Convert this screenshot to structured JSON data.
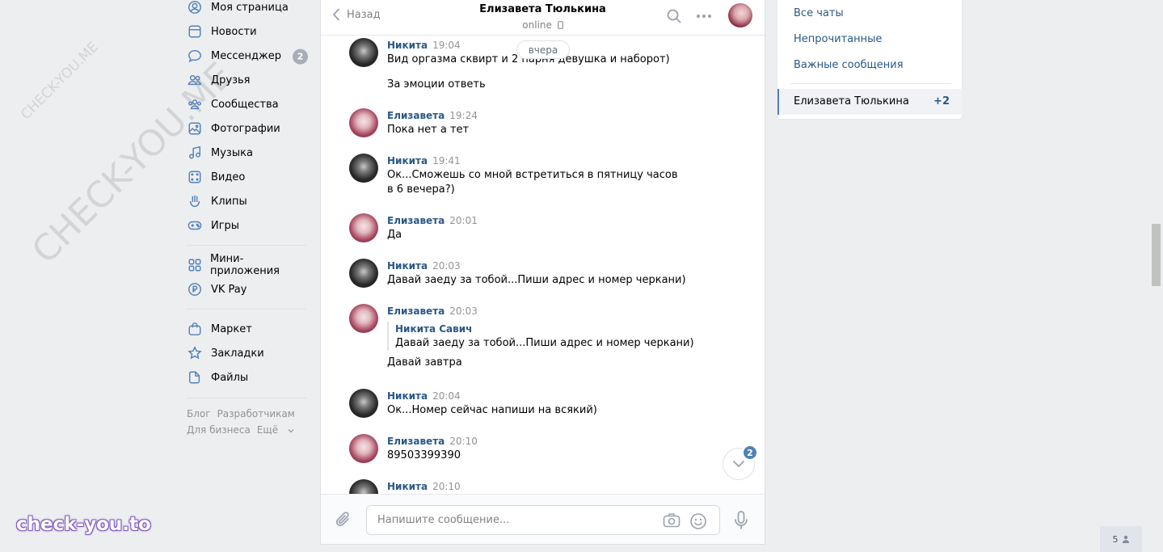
{
  "nav": {
    "items": [
      {
        "label": "Моя страница",
        "icon": "user-circle-icon"
      },
      {
        "label": "Новости",
        "icon": "news-icon"
      },
      {
        "label": "Мессенджер",
        "icon": "message-icon",
        "badge": "2"
      },
      {
        "label": "Друзья",
        "icon": "friends-icon"
      },
      {
        "label": "Сообщества",
        "icon": "communities-icon"
      },
      {
        "label": "Фотографии",
        "icon": "photo-icon"
      },
      {
        "label": "Музыка",
        "icon": "music-icon"
      },
      {
        "label": "Видео",
        "icon": "video-icon"
      },
      {
        "label": "Клипы",
        "icon": "clips-icon"
      },
      {
        "label": "Игры",
        "icon": "games-icon"
      }
    ],
    "items2": [
      {
        "label": "Мини-приложения",
        "icon": "apps-icon"
      },
      {
        "label": "VK Pay",
        "icon": "vkpay-icon"
      }
    ],
    "items3": [
      {
        "label": "Маркет",
        "icon": "market-icon"
      },
      {
        "label": "Закладки",
        "icon": "bookmark-icon"
      },
      {
        "label": "Файлы",
        "icon": "files-icon"
      }
    ],
    "footer": [
      "Блог",
      "Разработчикам",
      "Для бизнеса",
      "Ещё"
    ]
  },
  "chat": {
    "back_label": "Назад",
    "title": "Елизавета Тюлькина",
    "status": "online",
    "date_divider": "вчера",
    "messages": [
      {
        "author": "Никита",
        "time": "19:04",
        "text": "Вид оргазма сквирт и 2 парня девушка и наборот)",
        "text2": "За эмоции ответь"
      },
      {
        "author": "Елизавета",
        "time": "19:24",
        "text": "Пока нет а тет"
      },
      {
        "author": "Никита",
        "time": "19:41",
        "text": "Ок...Сможешь со мной встретиться в пятницу часов в 6 вечера?)"
      },
      {
        "author": "Елизавета",
        "time": "20:01",
        "text": "Да"
      },
      {
        "author": "Никита",
        "time": "20:03",
        "text": "Давай заеду за тобой...Пиши адрес и номер черкани)"
      },
      {
        "author": "Елизавета",
        "time": "20:03",
        "fwd_author": "Никита Савич",
        "fwd_text": "Давай заеду за тобой...Пиши адрес и номер черкани)",
        "text": "Давай завтра"
      },
      {
        "author": "Никита",
        "time": "20:04",
        "text": "Ок...Номер сейчас напиши на всякий)"
      },
      {
        "author": "Елизавета",
        "time": "20:10",
        "text": "89503399390"
      },
      {
        "author": "Никита",
        "time": "20:10"
      }
    ],
    "unread_badge": "2",
    "input_placeholder": "Напишите сообщение..."
  },
  "right_panel": {
    "links": [
      "Все чаты",
      "Непрочитанные",
      "Важные сообщения"
    ],
    "selected_chat": "Елизавета Тюлькина",
    "selected_count": "+2"
  },
  "online_count": "5",
  "watermark_small": "CHECK-YOU.ME",
  "watermark_large": "CHECK-YOU.ME",
  "brand": "check-you.to",
  "colors": {
    "link": "#2a5885",
    "accent": "#5181b8",
    "background": "#edeef0"
  }
}
